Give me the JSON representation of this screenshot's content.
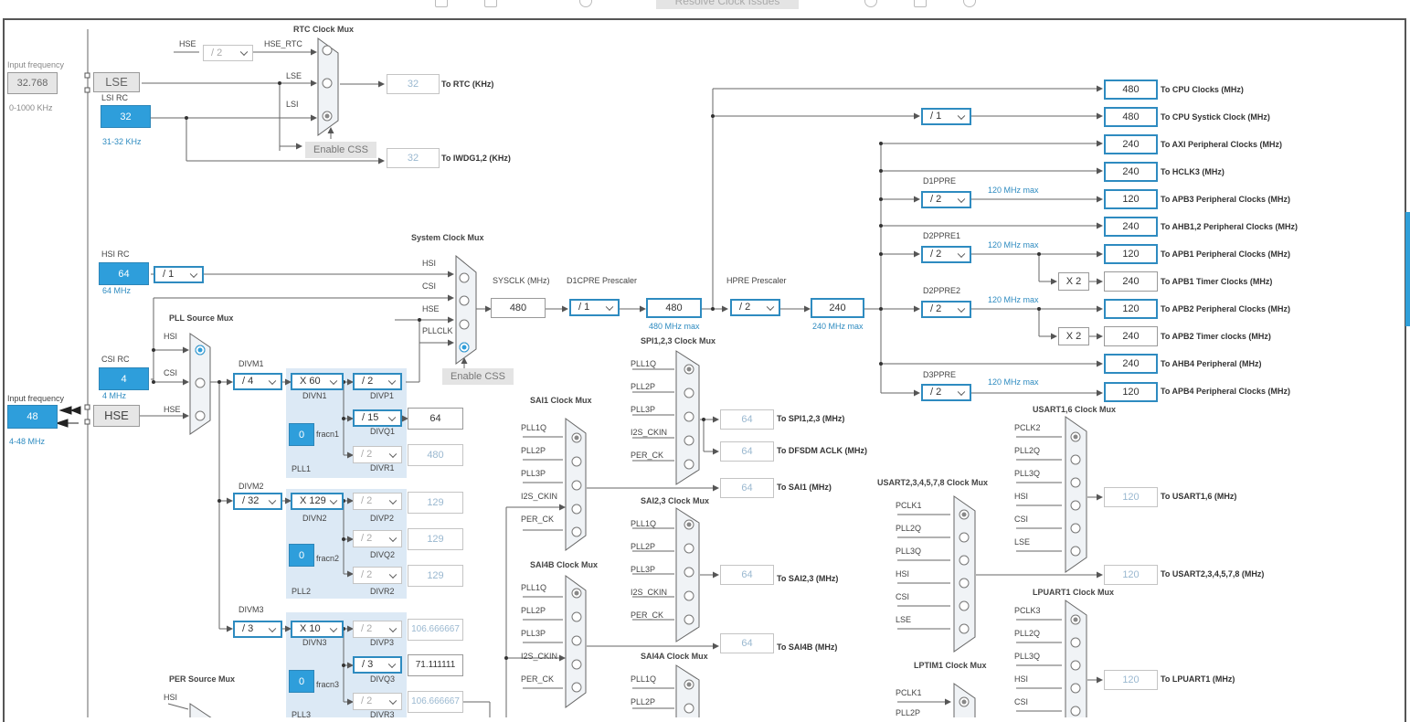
{
  "toolbar": {
    "resolve_label": "Resolve Clock Issues"
  },
  "left": {
    "input_freq_top_label": "Input frequency",
    "lse_freq": "32.768",
    "lse_range": "0-1000 KHz",
    "lse": "LSE",
    "lsi_rc_label": "LSI RC",
    "lsi_value": "32",
    "lsi_range": "31-32 KHz",
    "hsi_rc_label": "HSI RC",
    "hsi_value": "64",
    "hsi_range": "64 MHz",
    "hsi_div": "/ 1",
    "csi_rc_label": "CSI RC",
    "csi_value": "4",
    "csi_range": "4 MHz",
    "input_freq_bottom_label": "Input frequency",
    "hse_freq": "48",
    "hse": "HSE",
    "hse_range": "4-48 MHz"
  },
  "rtc": {
    "title": "RTC Clock Mux",
    "hse_label": "HSE",
    "hse_div": "/ 2",
    "hse_rtc_label": "HSE_RTC",
    "lse_in": "LSE",
    "lsi_in": "LSI",
    "value": "32",
    "to_rtc": "To RTC (KHz)",
    "enable_css": "Enable CSS",
    "iwdg_value": "32",
    "to_iwdg": "To IWDG1,2 (KHz)"
  },
  "sysmux": {
    "title": "System Clock Mux",
    "in_hsi": "HSI",
    "in_csi": "CSI",
    "in_hse": "HSE",
    "in_pllclk": "PLLCLK",
    "enable_css": "Enable CSS",
    "sysclk_label": "SYSCLK (MHz)",
    "sysclk": "480",
    "d1cpre_label": "D1CPRE Prescaler",
    "d1cpre": "/ 1",
    "cpu_freq": "480",
    "cpu_max": "480 MHz max",
    "hpre_label": "HPRE Prescaler",
    "hpre": "/ 2",
    "hclk": "240",
    "hclk_max": "240 MHz max"
  },
  "pllsrc": {
    "title": "PLL Source Mux",
    "in_hsi": "HSI",
    "in_csi": "CSI",
    "in_hse": "HSE"
  },
  "pll1": {
    "divm_label": "DIVM1",
    "divm": "/ 4",
    "divn": "X 60",
    "divn_label": "DIVN1",
    "frac": "0",
    "frac_label": "fracn1",
    "name": "PLL1",
    "divp": "/ 2",
    "divp_label": "DIVP1",
    "divq": "/ 15",
    "divq_label": "DIVQ1",
    "divq_out": "64",
    "divr": "/ 2",
    "divr_label": "DIVR1",
    "divr_out": "480"
  },
  "pll2": {
    "divm_label": "DIVM2",
    "divm": "/ 32",
    "divn": "X 129",
    "divn_label": "DIVN2",
    "frac": "0",
    "frac_label": "fracn2",
    "name": "PLL2",
    "divp": "/ 2",
    "divp_label": "DIVP2",
    "divp_out": "129",
    "divq": "/ 2",
    "divq_label": "DIVQ2",
    "divq_out": "129",
    "divr": "/ 2",
    "divr_label": "DIVR2",
    "divr_out": "129"
  },
  "pll3": {
    "divm_label": "DIVM3",
    "divm": "/ 3",
    "divn": "X 10",
    "divn_label": "DIVN3",
    "frac": "0",
    "frac_label": "fracn3",
    "name": "PLL3",
    "divp": "/ 2",
    "divp_label": "DIVP3",
    "divp_out": "106.666667",
    "divq": "/ 3",
    "divq_label": "DIVQ3",
    "divq_out": "71.111111",
    "divr": "/ 2",
    "divr_label": "DIVR3",
    "divr_out": "106.666667"
  },
  "persrc": {
    "title": "PER Source Mux",
    "in_hsi": "HSI"
  },
  "muxes": {
    "sai1": {
      "title": "SAI1 Clock Mux",
      "inputs": [
        "PLL1Q",
        "PLL2P",
        "PLL3P",
        "I2S_CKIN",
        "PER_CK"
      ]
    },
    "sai4b": {
      "title": "SAI4B Clock Mux",
      "inputs": [
        "PLL1Q",
        "PLL2P",
        "PLL3P",
        "I2S_CKIN",
        "PER_CK"
      ]
    },
    "spi": {
      "title": "SPI1,2,3 Clock Mux",
      "inputs": [
        "PLL1Q",
        "PLL2P",
        "PLL3P",
        "I2S_CKIN",
        "PER_CK"
      ]
    },
    "sai23": {
      "title": "SAI2,3 Clock Mux",
      "inputs": [
        "PLL1Q",
        "PLL2P",
        "PLL3P",
        "I2S_CKIN",
        "PER_CK"
      ]
    },
    "sai4a": {
      "title": "SAI4A Clock Mux",
      "inputs": [
        "PLL1Q",
        "PLL2P"
      ]
    },
    "usart16": {
      "title": "USART1,6 Clock Mux",
      "inputs": [
        "PCLK2",
        "PLL2Q",
        "PLL3Q",
        "HSI",
        "CSI",
        "LSE"
      ]
    },
    "usart2": {
      "title": "USART2,3,4,5,7,8 Clock Mux",
      "inputs": [
        "PCLK1",
        "PLL2Q",
        "PLL3Q",
        "HSI",
        "CSI",
        "LSE"
      ]
    },
    "lpuart1": {
      "title": "LPUART1 Clock Mux",
      "inputs": [
        "PCLK3",
        "PLL2Q",
        "PLL3Q",
        "HSI",
        "CSI"
      ]
    },
    "lptim1": {
      "title": "LPTIM1 Clock Mux",
      "inputs": [
        "PCLK1",
        "PLL2P"
      ]
    }
  },
  "periph_out": [
    {
      "value": "64",
      "label": "To SPI1,2,3 (MHz)"
    },
    {
      "value": "64",
      "label": "To DFSDM ACLK (MHz)"
    },
    {
      "value": "64",
      "label": "To SAI1 (MHz)"
    },
    {
      "value": "64",
      "label": "To SAI2,3 (MHz)"
    },
    {
      "value": "64",
      "label": "To SAI4B (MHz)"
    },
    {
      "value": "120",
      "label": "To USART1,6 (MHz)"
    },
    {
      "value": "120",
      "label": "To USART2,3,4,5,7,8 (MHz)"
    },
    {
      "value": "120",
      "label": "To LPUART1 (MHz)"
    }
  ],
  "right": {
    "cpu_systick_div": "/ 1",
    "d1ppre_label": "D1PPRE",
    "d1ppre": "/ 2",
    "d2ppre1_label": "D2PPRE1",
    "d2ppre1": "/ 2",
    "d2ppre2_label": "D2PPRE2",
    "d2ppre2": "/ 2",
    "d3ppre_label": "D3PPRE",
    "d3ppre": "/ 2",
    "max120": "120 MHz max",
    "x2": "X 2",
    "outputs": [
      {
        "value": "480",
        "label": "To CPU Clocks (MHz)"
      },
      {
        "value": "480",
        "label": "To CPU Systick Clock (MHz)"
      },
      {
        "value": "240",
        "label": "To AXI Peripheral Clocks (MHz)"
      },
      {
        "value": "240",
        "label": "To HCLK3 (MHz)"
      },
      {
        "value": "120",
        "label": "To APB3 Peripheral Clocks (MHz)"
      },
      {
        "value": "240",
        "label": "To AHB1,2 Peripheral Clocks (MHz)"
      },
      {
        "value": "120",
        "label": "To APB1 Peripheral Clocks (MHz)"
      },
      {
        "value": "240",
        "label": "To APB1 Timer Clocks (MHz)"
      },
      {
        "value": "120",
        "label": "To APB2 Peripheral Clocks (MHz)"
      },
      {
        "value": "240",
        "label": "To APB2 Timer clocks (MHz)"
      },
      {
        "value": "240",
        "label": "To AHB4 Peripheral (MHz)"
      },
      {
        "value": "120",
        "label": "To APB4 Peripheral Clocks (MHz)"
      }
    ]
  }
}
